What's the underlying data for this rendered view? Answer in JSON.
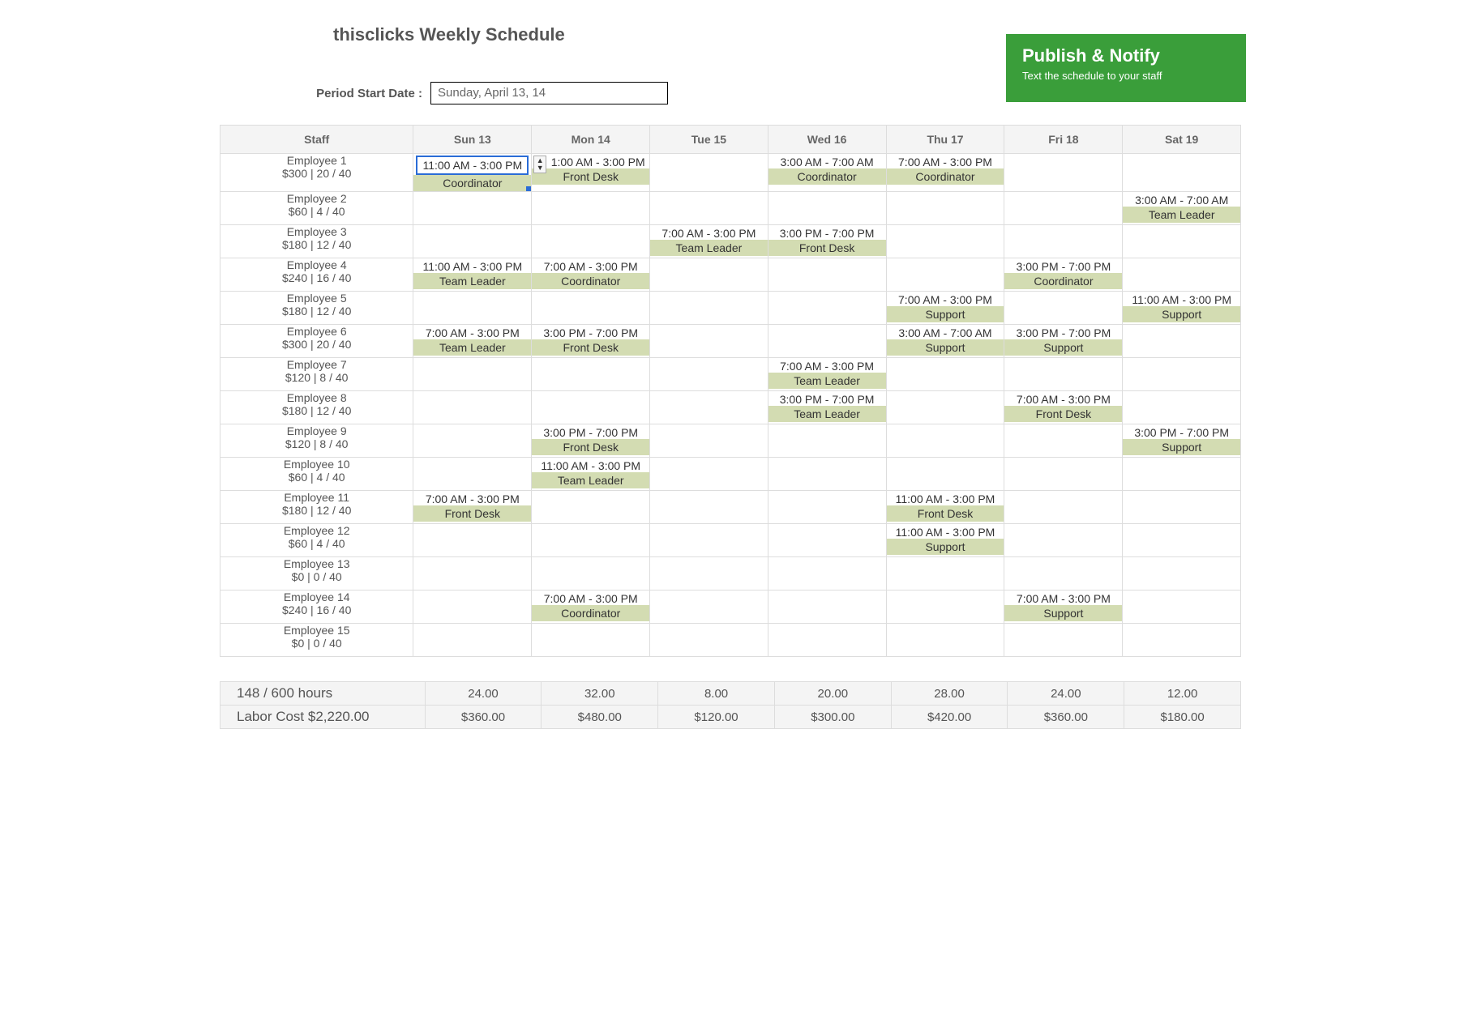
{
  "title": "thisclicks Weekly Schedule",
  "period_label": "Period Start Date :",
  "period_value": "Sunday, April 13, 14",
  "publish": {
    "title": "Publish & Notify",
    "subtitle": "Text the schedule to your staff"
  },
  "headers": {
    "staff": "Staff",
    "days": [
      "Sun 13",
      "Mon 14",
      "Tue 15",
      "Wed 16",
      "Thu 17",
      "Fri 18",
      "Sat 19"
    ]
  },
  "employees": [
    {
      "name": "Employee 1",
      "stats": "$300 | 20 / 40",
      "shifts": [
        {
          "time": "11:00 AM - 3:00 PM",
          "role": "Coordinator",
          "selected": true
        },
        {
          "time": "1:00 AM - 3:00 PM",
          "role": "Front Desk",
          "stepper": true
        },
        null,
        {
          "time": "3:00 AM - 7:00 AM",
          "role": "Coordinator"
        },
        {
          "time": "7:00 AM - 3:00 PM",
          "role": "Coordinator"
        },
        null,
        null
      ]
    },
    {
      "name": "Employee 2",
      "stats": "$60 | 4 / 40",
      "shifts": [
        null,
        null,
        null,
        null,
        null,
        null,
        {
          "time": "3:00 AM - 7:00 AM",
          "role": "Team Leader"
        }
      ]
    },
    {
      "name": "Employee 3",
      "stats": "$180 | 12 / 40",
      "shifts": [
        null,
        null,
        {
          "time": "7:00 AM - 3:00 PM",
          "role": "Team Leader"
        },
        {
          "time": "3:00 PM - 7:00 PM",
          "role": "Front Desk"
        },
        null,
        null,
        null
      ]
    },
    {
      "name": "Employee 4",
      "stats": "$240 | 16 / 40",
      "shifts": [
        {
          "time": "11:00 AM - 3:00 PM",
          "role": "Team Leader"
        },
        {
          "time": "7:00 AM - 3:00 PM",
          "role": "Coordinator"
        },
        null,
        null,
        null,
        {
          "time": "3:00 PM - 7:00 PM",
          "role": "Coordinator"
        },
        null
      ]
    },
    {
      "name": "Employee 5",
      "stats": "$180 | 12 / 40",
      "shifts": [
        null,
        null,
        null,
        null,
        {
          "time": "7:00 AM - 3:00 PM",
          "role": "Support"
        },
        null,
        {
          "time": "11:00 AM - 3:00 PM",
          "role": "Support"
        }
      ]
    },
    {
      "name": "Employee 6",
      "stats": "$300 | 20 / 40",
      "shifts": [
        {
          "time": "7:00 AM - 3:00 PM",
          "role": "Team Leader"
        },
        {
          "time": "3:00 PM - 7:00 PM",
          "role": "Front Desk"
        },
        null,
        null,
        {
          "time": "3:00 AM - 7:00 AM",
          "role": "Support"
        },
        {
          "time": "3:00 PM - 7:00 PM",
          "role": "Support"
        },
        null
      ]
    },
    {
      "name": "Employee 7",
      "stats": "$120 | 8 / 40",
      "shifts": [
        null,
        null,
        null,
        {
          "time": "7:00 AM - 3:00 PM",
          "role": "Team Leader"
        },
        null,
        null,
        null
      ]
    },
    {
      "name": "Employee 8",
      "stats": "$180 | 12 / 40",
      "shifts": [
        null,
        null,
        null,
        {
          "time": "3:00 PM - 7:00 PM",
          "role": "Team Leader"
        },
        null,
        {
          "time": "7:00 AM - 3:00 PM",
          "role": "Front Desk"
        },
        null
      ]
    },
    {
      "name": "Employee 9",
      "stats": "$120 | 8 / 40",
      "shifts": [
        null,
        {
          "time": "3:00 PM - 7:00 PM",
          "role": "Front Desk"
        },
        null,
        null,
        null,
        null,
        {
          "time": "3:00 PM - 7:00 PM",
          "role": "Support"
        }
      ]
    },
    {
      "name": "Employee 10",
      "stats": "$60 | 4 / 40",
      "shifts": [
        null,
        {
          "time": "11:00 AM - 3:00 PM",
          "role": "Team Leader"
        },
        null,
        null,
        null,
        null,
        null
      ]
    },
    {
      "name": "Employee 11",
      "stats": "$180 | 12 / 40",
      "shifts": [
        {
          "time": "7:00 AM - 3:00 PM",
          "role": "Front Desk"
        },
        null,
        null,
        null,
        {
          "time": "11:00 AM - 3:00 PM",
          "role": "Front Desk"
        },
        null,
        null
      ]
    },
    {
      "name": "Employee 12",
      "stats": "$60 | 4 / 40",
      "shifts": [
        null,
        null,
        null,
        null,
        {
          "time": "11:00 AM - 3:00 PM",
          "role": "Support"
        },
        null,
        null
      ]
    },
    {
      "name": "Employee 13",
      "stats": "$0 | 0 / 40",
      "shifts": [
        null,
        null,
        null,
        null,
        null,
        null,
        null
      ]
    },
    {
      "name": "Employee 14",
      "stats": "$240 | 16 / 40",
      "shifts": [
        null,
        {
          "time": "7:00 AM - 3:00 PM",
          "role": "Coordinator"
        },
        null,
        null,
        null,
        {
          "time": "7:00 AM - 3:00 PM",
          "role": "Support"
        },
        null
      ]
    },
    {
      "name": "Employee 15",
      "stats": "$0 | 0 / 40",
      "shifts": [
        null,
        null,
        null,
        null,
        null,
        null,
        null
      ]
    }
  ],
  "footer": {
    "hours_label": "148 / 600 hours",
    "hours": [
      "24.00",
      "32.00",
      "8.00",
      "20.00",
      "28.00",
      "24.00",
      "12.00"
    ],
    "cost_label": "Labor Cost $2,220.00",
    "costs": [
      "$360.00",
      "$480.00",
      "$120.00",
      "$300.00",
      "$420.00",
      "$360.00",
      "$180.00"
    ]
  }
}
